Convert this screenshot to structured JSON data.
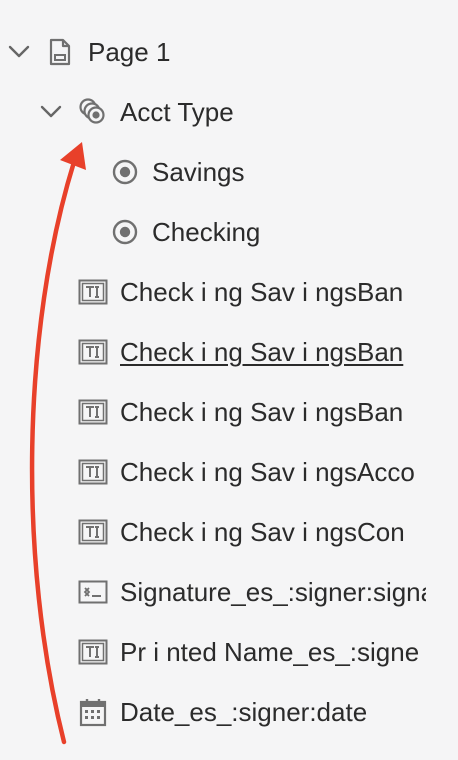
{
  "tree": {
    "page": {
      "label": "Page 1",
      "expanded": true,
      "icon": "document-icon"
    },
    "group": {
      "label": "Acct Type",
      "expanded": true,
      "icon": "radio-group-icon"
    },
    "radios": [
      {
        "label": "Savings",
        "icon": "radio-button-icon"
      },
      {
        "label": "Checking",
        "icon": "radio-button-icon"
      }
    ],
    "fields": [
      {
        "label": "Check i ng Sav i ngsBan",
        "icon": "text-field-icon",
        "underlined": false
      },
      {
        "label": "Check i ng Sav i ngsBan",
        "icon": "text-field-icon",
        "underlined": true
      },
      {
        "label": "Check i ng Sav i ngsBan",
        "icon": "text-field-icon",
        "underlined": false
      },
      {
        "label": "Check i ng Sav i ngsAcco",
        "icon": "text-field-icon",
        "underlined": false
      },
      {
        "label": "Check i ng Sav i ngsCon",
        "icon": "text-field-icon",
        "underlined": false
      },
      {
        "label": "Signature_es_:signer:signa",
        "icon": "signature-field-icon",
        "underlined": false
      },
      {
        "label": "Pr i nted Name_es_:signe",
        "icon": "text-field-icon",
        "underlined": false
      },
      {
        "label": "Date_es_:signer:date",
        "icon": "date-field-icon",
        "underlined": false
      }
    ]
  },
  "annotation": {
    "color": "#e8402a",
    "icon": "red-arrow-icon"
  }
}
